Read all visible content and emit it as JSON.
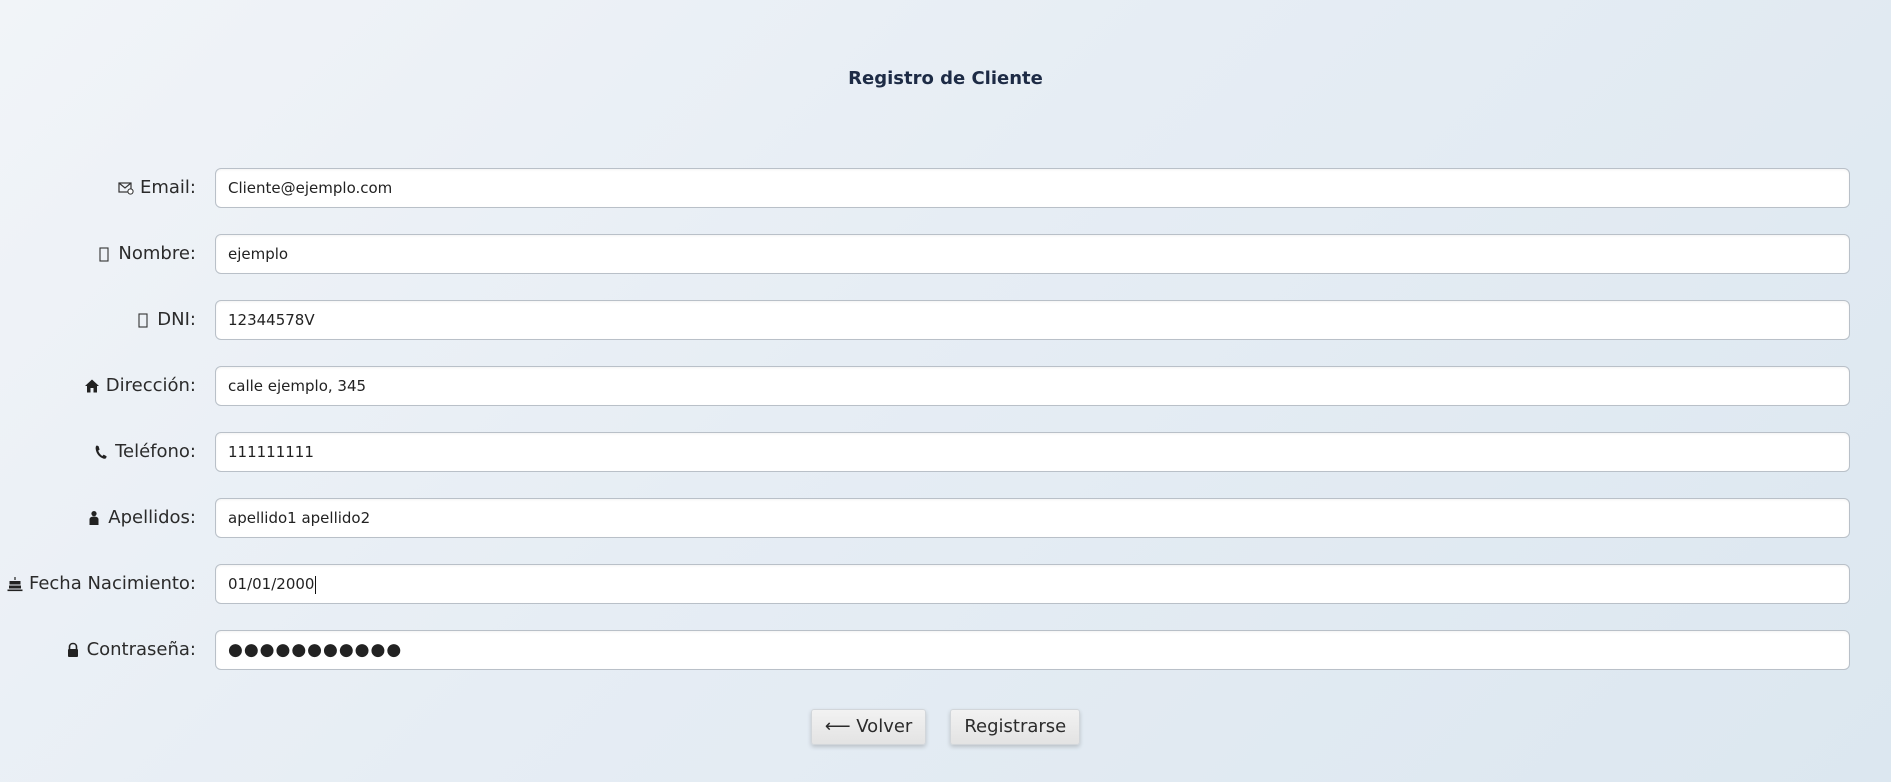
{
  "page": {
    "title": "Registro de Cliente"
  },
  "form": {
    "fields": [
      {
        "key": "email",
        "icon": "envelope-icon",
        "label": "Email:",
        "value": "Cliente@ejemplo.com"
      },
      {
        "key": "nombre",
        "icon": "missing-glyph-icon",
        "label": "Nombre:",
        "value": "ejemplo"
      },
      {
        "key": "dni",
        "icon": "missing-glyph-icon",
        "label": "DNI:",
        "value": "12344578V"
      },
      {
        "key": "direccion",
        "icon": "house-icon",
        "label": "Dirección:",
        "value": "calle ejemplo, 345"
      },
      {
        "key": "telefono",
        "icon": "phone-icon",
        "label": "Teléfono:",
        "value": "111111111"
      },
      {
        "key": "apellidos",
        "icon": "person-icon",
        "label": "Apellidos:",
        "value": "apellido1 apellido2"
      },
      {
        "key": "fecha",
        "icon": "cake-icon",
        "label": "Fecha Nacimiento:",
        "value": "01/01/2000"
      },
      {
        "key": "password",
        "icon": "lock-icon",
        "label": "Contraseña:",
        "value": "●●●●●●●●●●●"
      }
    ]
  },
  "buttons": {
    "back_label": "⟵ Volver",
    "register_label": "Registrarse"
  }
}
